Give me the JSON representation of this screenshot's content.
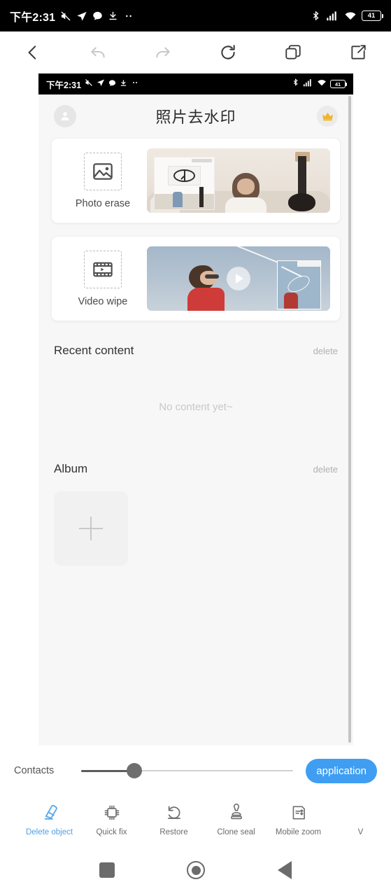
{
  "outer_status_bar": {
    "time": "下午2:31",
    "battery_level": "41",
    "left_icons": [
      "mute-icon",
      "send-icon",
      "message-icon",
      "download-icon",
      "more-dots-icon"
    ],
    "right_icons": [
      "bluetooth-icon",
      "signal-icon",
      "wifi-icon",
      "battery-icon"
    ]
  },
  "browser_toolbar": {
    "buttons": [
      {
        "name": "back",
        "icon": "chevron-left-icon"
      },
      {
        "name": "undo",
        "icon": "undo-arrow-icon"
      },
      {
        "name": "redo",
        "icon": "redo-arrow-icon"
      },
      {
        "name": "refresh",
        "icon": "refresh-icon"
      },
      {
        "name": "tabs",
        "icon": "tabs-icon"
      },
      {
        "name": "share",
        "icon": "share-icon"
      }
    ]
  },
  "inner_status_bar": {
    "time": "下午2:31",
    "battery_level": "41"
  },
  "app": {
    "header": {
      "title": "照片去水印",
      "avatar_icon": "person-icon",
      "vip_icon": "crown-icon",
      "vip_color": "#f0b429"
    },
    "cards": [
      {
        "label": "Photo erase",
        "icon": "image-frame-icon"
      },
      {
        "label": "Video wipe",
        "icon": "film-strip-icon"
      }
    ],
    "recent": {
      "title": "Recent content",
      "delete_label": "delete",
      "empty_text": "No content yet~"
    },
    "album": {
      "title": "Album",
      "delete_label": "delete",
      "add_icon": "plus-icon"
    }
  },
  "slider_row": {
    "label": "Contacts",
    "value_percent": 25,
    "apply_label": "application",
    "apply_color": "#3f9ef2"
  },
  "tool_strip": {
    "active_color": "#4d9fe8",
    "tools": [
      {
        "label": "Delete object",
        "icon": "eraser-icon",
        "active": true
      },
      {
        "label": "Quick fix",
        "icon": "chip-icon",
        "active": false
      },
      {
        "label": "Restore",
        "icon": "undo-circle-icon",
        "active": false
      },
      {
        "label": "Clone seal",
        "icon": "stamp-icon",
        "active": false
      },
      {
        "label": "Mobile zoom",
        "icon": "move-text-icon",
        "active": false
      },
      {
        "label": "V",
        "icon": "cut-off-icon",
        "active": false
      }
    ]
  },
  "nav_bar": {
    "buttons": [
      {
        "name": "recents",
        "icon": "square-icon"
      },
      {
        "name": "home",
        "icon": "circle-icon"
      },
      {
        "name": "back",
        "icon": "triangle-back-icon"
      }
    ]
  }
}
